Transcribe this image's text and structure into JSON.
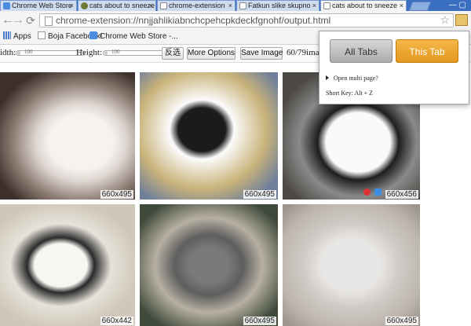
{
  "tabs": [
    {
      "title": "Chrome Web Store",
      "icon": "chrome-store-icon",
      "active": false
    },
    {
      "title": "cats about to sneeze",
      "icon": "tab-favicon-icon",
      "active": false
    },
    {
      "title": "chrome-extension",
      "icon": "page-icon",
      "active": false
    },
    {
      "title": "Fatkun slike skupno",
      "icon": "page-icon",
      "active": false
    },
    {
      "title": "cats about to sneeze",
      "icon": "page-icon",
      "active": true
    }
  ],
  "toolbar": {
    "url": "chrome-extension://nnjjahlikiabnchcpehcpkdeckfgnohf/output.html",
    "back_icon": "back-arrow-icon",
    "forward_icon": "forward-arrow-icon",
    "reload_icon": "reload-icon",
    "star_icon": "star-icon",
    "extension_icon": "fatkun-extension-icon"
  },
  "bookmarks": [
    {
      "label": "Apps",
      "icon": "apps-icon"
    },
    {
      "label": "Boja Facebook!",
      "icon": "bookmark-page-icon"
    },
    {
      "label": "Chrome Web Store -...",
      "icon": "chrome-store-icon"
    }
  ],
  "controls": {
    "width_label": "idth:",
    "height_label": "Height:",
    "width_slider_value": "100",
    "height_slider_value": "100",
    "invert_label": "反选",
    "more_options_label": "More Options",
    "save_image_label": "Save Image",
    "counter": "60/79imag"
  },
  "photos": [
    {
      "size": "660x495"
    },
    {
      "size": "660x495"
    },
    {
      "size": "660x456"
    },
    {
      "size": "660x442"
    },
    {
      "size": "660x495"
    },
    {
      "size": "660x495"
    }
  ],
  "popup": {
    "all_tabs_label": "All Tabs",
    "this_tab_label": "This Tab",
    "open_multi_label": "Open multi page?",
    "short_key_label": "Short Key: Alt + Z"
  },
  "colors": {
    "tab_strip": "#3a6fc2",
    "this_tab_button": "#e39a1e",
    "all_tabs_button": "#adadad"
  }
}
